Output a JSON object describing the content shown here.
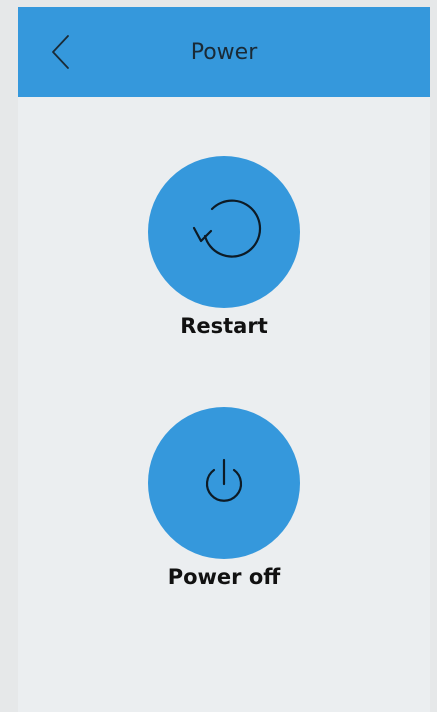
{
  "header": {
    "title": "Power",
    "back_icon": "chevron-left-icon"
  },
  "actions": [
    {
      "label": "Restart",
      "icon": "restart-icon"
    },
    {
      "label": "Power off",
      "icon": "power-icon"
    }
  ],
  "colors": {
    "accent": "#3598dc",
    "background": "#ebeef0",
    "frame": "#e6e8e9",
    "text": "#111111"
  }
}
